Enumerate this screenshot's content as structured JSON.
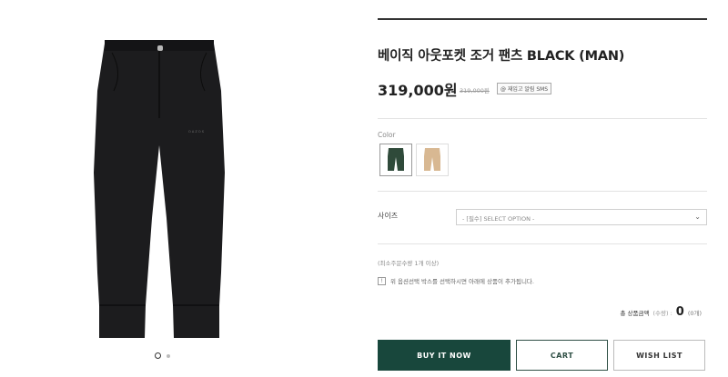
{
  "product": {
    "title": "베이직 아웃포켓 조거 팬츠 BLACK (MAN)",
    "price": "319,000원",
    "original_price": "319,000원",
    "reward": "@ 재입고 알림 SMS"
  },
  "color": {
    "label": "Color",
    "options": [
      {
        "name": "dark-green",
        "hex": "#2f4a3a"
      },
      {
        "name": "beige",
        "hex": "#d8b892"
      }
    ]
  },
  "size": {
    "label": "사이즈",
    "placeholder": "- [필수] SELECT OPTION -"
  },
  "min_qty": "(최소주문수량 1개 이상)",
  "notice": {
    "icon": "!",
    "text": "위 옵션선택 박스를 선택하시면 아래에 상품이 추가됩니다."
  },
  "total": {
    "label": "총 상품금액",
    "qty": "(수량) :",
    "amount": "0",
    "count": "(0개)"
  },
  "buttons": {
    "buy": "BUY IT NOW",
    "cart": "CART",
    "wish": "WISH LIST"
  },
  "gallery": {
    "logo_text": "O A Z O S",
    "product_color": "#1c1c1e"
  }
}
